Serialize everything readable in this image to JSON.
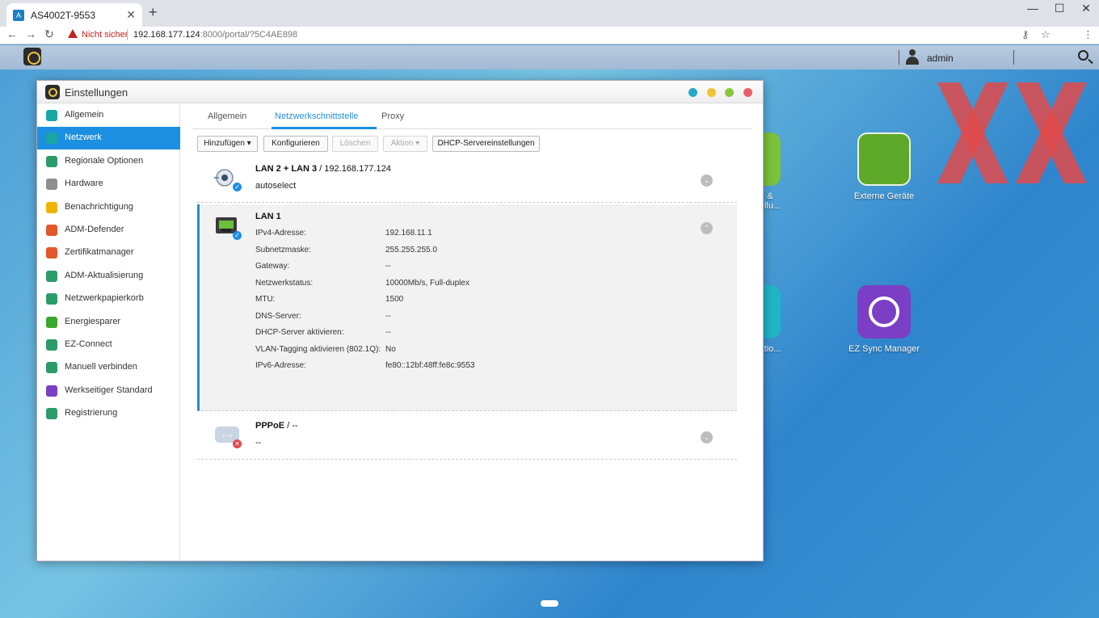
{
  "browser": {
    "tab_title": "AS4002T-9553",
    "tab_close": "✕",
    "newtab": "+",
    "security_warning": "Nicht sicher",
    "url_host": "192.168.177.124",
    "url_rest": ":8000/portal/?5C4AE898",
    "win_min": "—",
    "win_max": "☐",
    "win_close": "✕"
  },
  "adm_bar": {
    "username": "admin"
  },
  "desktop": {
    "apps": [
      {
        "label": "&\nellu...",
        "icon_color": "#7cc23b"
      },
      {
        "label": "Externe Geräte",
        "icon_color": "#5ea82a"
      },
      {
        "label": "atio...",
        "icon_color": "#1fb5c7"
      },
      {
        "label": "EZ Sync Manager",
        "icon_color": "#7a3fc4"
      }
    ]
  },
  "window": {
    "title": "Einstellungen",
    "controls": {
      "c1": "#26a9c7",
      "c2": "#f2c233",
      "c3": "#8cc63f",
      "c4": "#e8616a"
    }
  },
  "sidebar": {
    "active_index": 1,
    "items": [
      {
        "label": "Allgemein",
        "icon_color": "#1aa6a6"
      },
      {
        "label": "Netzwerk",
        "icon_color": "#1aa6a6"
      },
      {
        "label": "Regionale Optionen",
        "icon_color": "#2c9b6a"
      },
      {
        "label": "Hardware",
        "icon_color": "#8e8e8e"
      },
      {
        "label": "Benachrichtigung",
        "icon_color": "#f0b400"
      },
      {
        "label": "ADM-Defender",
        "icon_color": "#e2572b"
      },
      {
        "label": "Zertifikatmanager",
        "icon_color": "#e2572b"
      },
      {
        "label": "ADM-Aktualisierung",
        "icon_color": "#2c9b6a"
      },
      {
        "label": "Netzwerkpapierkorb",
        "icon_color": "#2c9b6a"
      },
      {
        "label": "Energiesparer",
        "icon_color": "#3aa82c"
      },
      {
        "label": "EZ-Connect",
        "icon_color": "#2c9b6a"
      },
      {
        "label": "Manuell verbinden",
        "icon_color": "#2c9b6a"
      },
      {
        "label": "Werkseitiger Standard",
        "icon_color": "#7a3fc4"
      },
      {
        "label": "Registrierung",
        "icon_color": "#2c9b6a"
      }
    ]
  },
  "tabs": [
    {
      "label": "Allgemein"
    },
    {
      "label": "Netzwerkschnittstelle"
    },
    {
      "label": "Proxy"
    }
  ],
  "toolbar": {
    "add": "Hinzufügen ▾",
    "configure": "Konfigurieren",
    "delete": "Löschen",
    "action": "Aktion ▾",
    "dhcp": "DHCP-Servereinstellungen"
  },
  "interfaces": {
    "lan23": {
      "name": "LAN 2 + LAN 3",
      "sep": " / ",
      "ip": "192.168.177.124",
      "mode": "autoselect"
    },
    "lan1": {
      "name": "LAN 1",
      "rows": [
        {
          "key": "IPv4-Adresse:",
          "value": "192.168.11.1"
        },
        {
          "key": "Subnetzmaske:",
          "value": "255.255.255.0"
        },
        {
          "key": "Gateway:",
          "value": "--"
        },
        {
          "key": "Netzwerkstatus:",
          "value": "10000Mb/s, Full-duplex"
        },
        {
          "key": "MTU:",
          "value": "1500"
        },
        {
          "key": "DNS-Server:",
          "value": "--"
        },
        {
          "key": "DHCP-Server aktivieren:",
          "value": "--"
        },
        {
          "key": "VLAN-Tagging aktivieren (802.1Q):",
          "value": "No"
        },
        {
          "key": "IPv6-Adresse:",
          "value": "fe80::12bf:48ff:fe8c:9553"
        }
      ]
    },
    "pppoe": {
      "name": "PPPoE",
      "sep": " / ",
      "value": "--",
      "sub": "--"
    }
  },
  "glyphs": {
    "chev_down": "⌄",
    "chev_up": "⌃",
    "check": "✓",
    "cross": "✕"
  }
}
